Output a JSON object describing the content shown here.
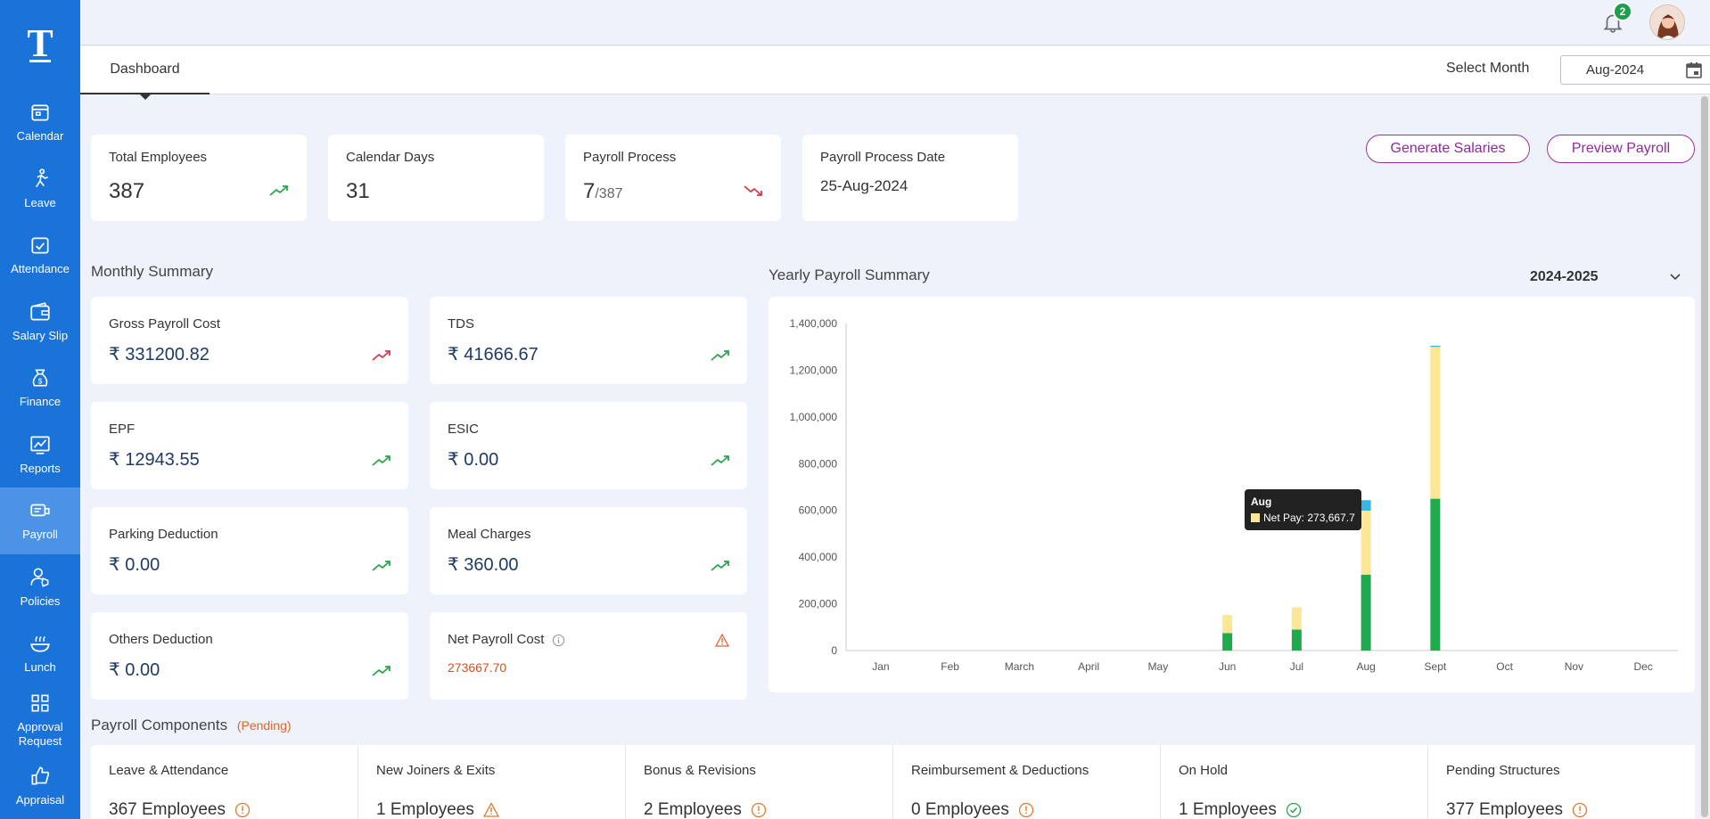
{
  "sidebar": {
    "logo": "T",
    "items": [
      {
        "label": "Calendar",
        "icon": "calendar-icon"
      },
      {
        "label": "Leave",
        "icon": "leave-icon"
      },
      {
        "label": "Attendance",
        "icon": "attendance-icon"
      },
      {
        "label": "Salary Slip",
        "icon": "wallet-icon"
      },
      {
        "label": "Finance",
        "icon": "money-bag-icon"
      },
      {
        "label": "Reports",
        "icon": "chart-icon"
      },
      {
        "label": "Payroll",
        "icon": "payroll-icon"
      },
      {
        "label": "Policies",
        "icon": "policies-icon"
      },
      {
        "label": "Lunch",
        "icon": "lunch-icon"
      },
      {
        "label": "Approval Request",
        "icon": "grid-icon"
      },
      {
        "label": "Appraisal",
        "icon": "thumbs-up-icon"
      }
    ],
    "active": "Payroll"
  },
  "topbar": {
    "notification_count": "2"
  },
  "header": {
    "tab": "Dashboard",
    "select_month_label": "Select Month",
    "month_value": "Aug-2024"
  },
  "stats": {
    "total_employees": {
      "label": "Total Employees",
      "value": "387",
      "trend": "up"
    },
    "calendar_days": {
      "label": "Calendar Days",
      "value": "31"
    },
    "payroll_process": {
      "label": "Payroll Process",
      "value": "7",
      "total": "/387",
      "trend": "down"
    },
    "payroll_process_date": {
      "label": "Payroll Process Date",
      "value": "25-Aug-2024"
    }
  },
  "actions": {
    "generate": "Generate Salaries",
    "preview": "Preview Payroll"
  },
  "monthly_summary": {
    "title": "Monthly Summary",
    "currency": "₹",
    "cards": [
      {
        "label": "Gross Payroll Cost",
        "value": "331200.82",
        "trend": "up-red"
      },
      {
        "label": "TDS",
        "value": "41666.67",
        "trend": "up"
      },
      {
        "label": "EPF",
        "value": "12943.55",
        "trend": "up"
      },
      {
        "label": "ESIC",
        "value": "0.00",
        "trend": "up"
      },
      {
        "label": "Parking Deduction",
        "value": "0.00",
        "trend": "up"
      },
      {
        "label": "Meal Charges",
        "value": "360.00",
        "trend": "up"
      },
      {
        "label": "Others Deduction",
        "value": "0.00",
        "trend": "up"
      }
    ],
    "net": {
      "label": "Net Payroll Cost",
      "value": "273667.70"
    }
  },
  "yearly": {
    "title": "Yearly Payroll Summary",
    "year": "2024-2025",
    "tooltip": {
      "month": "Aug",
      "text": "Net Pay: 273,667.7"
    }
  },
  "chart_data": {
    "type": "bar",
    "stacked": true,
    "categories": [
      "Jan",
      "Feb",
      "March",
      "April",
      "May",
      "Jun",
      "Jul",
      "Aug",
      "Sept",
      "Oct",
      "Nov",
      "Dec"
    ],
    "ylim": [
      0,
      1400000
    ],
    "yticks": [
      "0",
      "200,000",
      "400,000",
      "600,000",
      "800,000",
      "1,000,000",
      "1,200,000",
      "1,400,000"
    ],
    "series": [
      {
        "color": "#1faa4d",
        "values": [
          0,
          0,
          0,
          0,
          0,
          75000,
          90000,
          325000,
          650000,
          0,
          0,
          0
        ]
      },
      {
        "name": "Net Pay",
        "color": "#fbe795",
        "values": [
          0,
          0,
          0,
          0,
          0,
          78000,
          95000,
          273667.7,
          650000,
          0,
          0,
          0
        ]
      },
      {
        "color": "#35b7e8",
        "values": [
          0,
          0,
          0,
          0,
          0,
          0,
          0,
          45000,
          5000,
          0,
          0,
          0
        ]
      }
    ]
  },
  "components": {
    "title": "Payroll Components",
    "status": "(Pending)",
    "items": [
      {
        "label": "Leave & Attendance",
        "value": "367 Employees",
        "icon": "info-icon"
      },
      {
        "label": "New Joiners & Exits",
        "value": "1 Employees",
        "icon": "warning-icon"
      },
      {
        "label": "Bonus & Revisions",
        "value": "2 Employees",
        "icon": "info-icon"
      },
      {
        "label": "Reimbursement & Deductions",
        "value": "0 Employees",
        "icon": "info-icon"
      },
      {
        "label": "On Hold",
        "value": "1 Employees",
        "icon": "check-icon"
      },
      {
        "label": "Pending Structures",
        "value": "377 Employees",
        "icon": "info-icon"
      }
    ]
  }
}
